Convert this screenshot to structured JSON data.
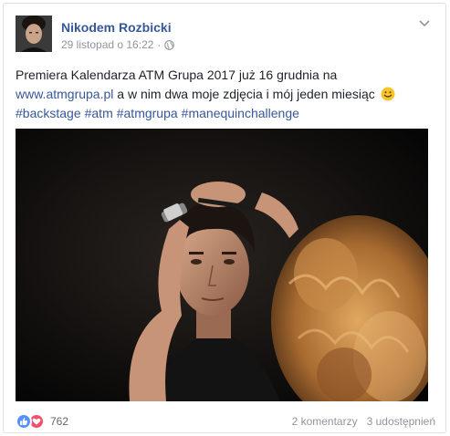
{
  "post": {
    "author": "Nikodem Rozbicki",
    "timestamp": "29 listopad o 16:22",
    "separator": "·",
    "text_before_link": "Premiera Kalendarza ATM Grupa 2017 już 16 grudnia na ",
    "link": "www.atmgrupa.pl",
    "text_after_link": " a w nim dwa moje zdjęcia i mój jeden miesiąc ",
    "hashtags": [
      "#backstage",
      "#atm",
      "#atmgrupa",
      "#manequinchallenge"
    ]
  },
  "footer": {
    "reaction_count": "762",
    "comments": "2 komentarzy",
    "shares": "3 udostępnień"
  },
  "icons": {
    "privacy": "globe-icon",
    "menu": "chevron-down-icon",
    "emoji": "smile-emoji-icon",
    "reaction_1": "like-reaction-icon",
    "reaction_2": "love-reaction-icon"
  },
  "colors": {
    "link": "#365899",
    "meta": "#90949c",
    "like": "#5890ff",
    "love": "#f25268"
  }
}
